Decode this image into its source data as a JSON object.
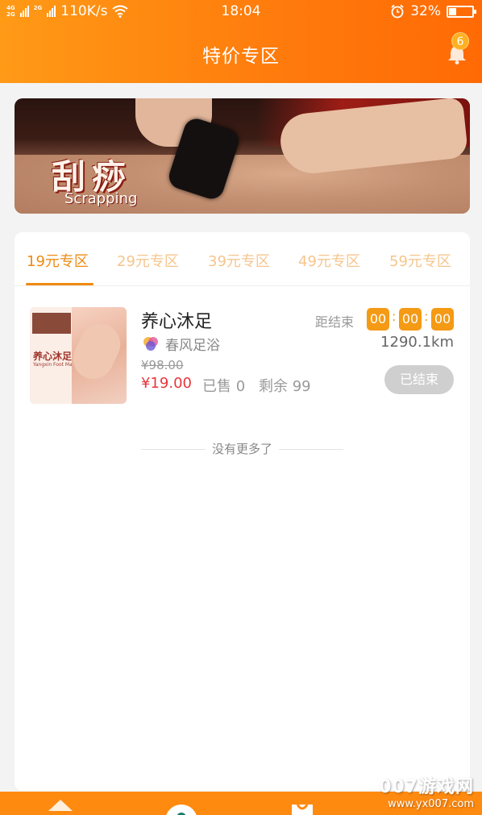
{
  "status_bar": {
    "network1": "4G",
    "network2": "2G",
    "network3": "2G",
    "speed": "110K/s",
    "time": "18:04",
    "battery": "32%"
  },
  "header": {
    "title": "特价专区",
    "notification_count": "6"
  },
  "banner": {
    "title_cn": "刮痧",
    "title_en": "Scrapping"
  },
  "tabs": [
    {
      "label": "19元专区",
      "active": true
    },
    {
      "label": "29元专区",
      "active": false
    },
    {
      "label": "39元专区",
      "active": false
    },
    {
      "label": "49元专区",
      "active": false
    },
    {
      "label": "59元专区",
      "active": false
    }
  ],
  "item": {
    "thumb_title": "养心沐足",
    "thumb_subtitle": "Yangxin Foot Massage",
    "name": "养心沐足",
    "shop": "春风足浴",
    "original_price": "¥98.00",
    "price": "¥19.00",
    "sold": "已售 0",
    "remaining": "剩余 99",
    "countdown_label": "距结束",
    "countdown": [
      "00",
      "00",
      "00"
    ],
    "distance": "1290.1km",
    "status_button": "已结束"
  },
  "no_more": "没有更多了",
  "watermark": {
    "brand": "007游戏网",
    "url": "www.yx007.com"
  },
  "colors": {
    "primary": "#ff8a10",
    "tab_active": "#ef8a12",
    "price": "#e8363b",
    "countdown": "#f49a14"
  }
}
